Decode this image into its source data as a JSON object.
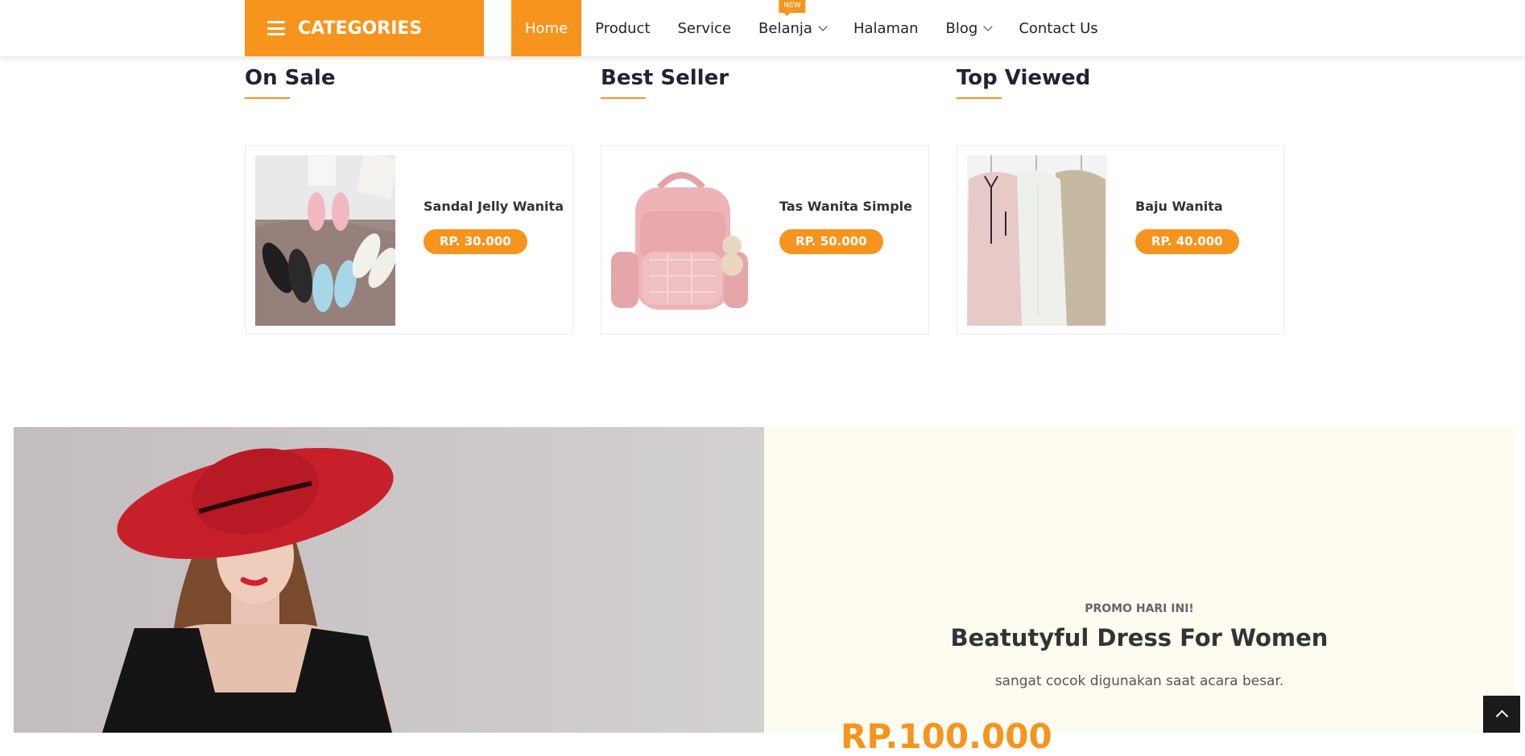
{
  "header": {
    "categories_label": "CATEGORIES",
    "nav": [
      {
        "label": "Home",
        "active": true
      },
      {
        "label": "Product"
      },
      {
        "label": "Service"
      },
      {
        "label": "Belanja",
        "badge": "NEW",
        "has_dropdown": true
      },
      {
        "label": "Halaman"
      },
      {
        "label": "Blog",
        "has_dropdown": true
      },
      {
        "label": "Contact Us"
      }
    ]
  },
  "sections": [
    {
      "title": "On Sale",
      "product": {
        "name": "Sandal Jelly Wanita",
        "price": "RP. 30.000"
      }
    },
    {
      "title": "Best Seller",
      "product": {
        "name": "Tas Wanita Simple",
        "price": "RP. 50.000"
      }
    },
    {
      "title": "Top Viewed",
      "product": {
        "name": "Baju Wanita",
        "price": "RP. 40.000"
      }
    }
  ],
  "promo": {
    "label": "PROMO HARI INI!",
    "title": "Beatutyful Dress For Women",
    "subtitle": "sangat cocok digunakan saat acara besar.",
    "price": "RP.100.000"
  },
  "colors": {
    "accent": "#f7941d",
    "dark": "#222233",
    "promo_bg": "#fefbf0"
  }
}
